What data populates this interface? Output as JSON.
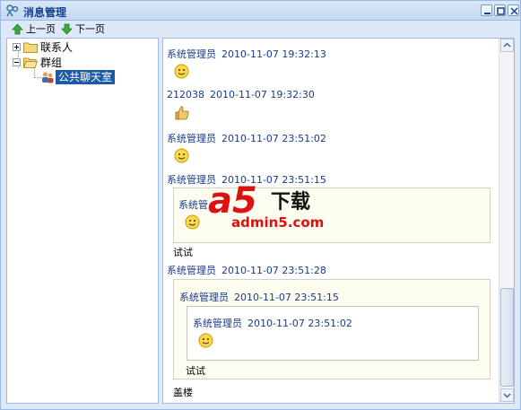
{
  "window": {
    "title": "消息管理"
  },
  "toolbar": {
    "prev_label": "上一页",
    "next_label": "下一页"
  },
  "tree": {
    "contacts": "联系人",
    "groups": "群组",
    "public_room": "公共聊天室"
  },
  "messages": {
    "m1": {
      "sender": "系统管理员",
      "time": "2010-11-07 19:32:13",
      "content": "smiley-icon"
    },
    "m2": {
      "sender": "212038",
      "time": "2010-11-07 19:32:30",
      "content": "thumbs-up-icon"
    },
    "m3": {
      "sender": "系统管理员",
      "time": "2010-11-07 23:51:02",
      "content": "smiley-icon"
    },
    "m4": {
      "sender": "系统管理员",
      "time": "2010-11-07 23:51:15",
      "quote": {
        "sender": "系统管",
        "content": "smiley-icon"
      },
      "text": "试试"
    },
    "m5": {
      "sender": "系统管理员",
      "time": "2010-11-07 23:51:28",
      "quote": {
        "sender": "系统管理员",
        "time": "2010-11-07 23:51:15",
        "inner": {
          "sender": "系统管理员",
          "time": "2010-11-07 23:51:02",
          "content": "smiley-icon"
        },
        "text": "试试"
      },
      "text": "盖楼"
    }
  },
  "watermark": {
    "brand": "a5",
    "suffix": "下载",
    "url": "admin5.com"
  },
  "colors": {
    "title_text": "#15428b",
    "sender_text": "#1a3a8a",
    "selected_bg": "#1c5aa6",
    "border": "#99bbe8"
  }
}
